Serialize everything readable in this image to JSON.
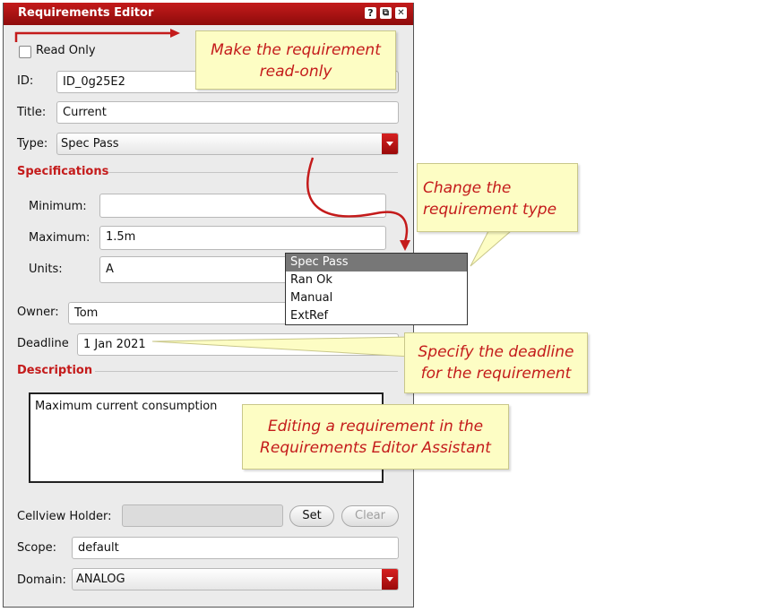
{
  "window": {
    "title": "Requirements Editor",
    "help_glyph": "?",
    "restore_glyph": "⧉",
    "close_glyph": "✕"
  },
  "readonly": {
    "label": "Read Only",
    "checked": false
  },
  "form": {
    "id": {
      "label": "ID:",
      "value": "ID_0g25E2"
    },
    "title": {
      "label": "Title:",
      "value": "Current"
    },
    "type": {
      "label": "Type:",
      "value": "Spec Pass"
    }
  },
  "specifications": {
    "heading": "Specifications",
    "minimum": {
      "label": "Minimum:",
      "value": ""
    },
    "maximum": {
      "label": "Maximum:",
      "value": "1.5m"
    },
    "units": {
      "label": "Units:",
      "value": "A"
    }
  },
  "owner": {
    "label": "Owner:",
    "value": "Tom"
  },
  "deadline": {
    "label": "Deadline",
    "value": "1 Jan 2021"
  },
  "description": {
    "heading": "Description",
    "value": "Maximum current consumption"
  },
  "cellview": {
    "label": "Cellview Holder:",
    "value": "",
    "set_label": "Set",
    "clear_label": "Clear"
  },
  "scope": {
    "label": "Scope:",
    "value": "default"
  },
  "domain": {
    "label": "Domain:",
    "value": "ANALOG"
  },
  "type_options": [
    "Spec Pass",
    "Ran Ok",
    "Manual",
    "ExtRef"
  ],
  "callouts": {
    "readonly": [
      "Make the requirement",
      "read-only"
    ],
    "type": [
      "Change the",
      "requirement type"
    ],
    "deadline": [
      "Specify the deadline",
      "for the requirement"
    ],
    "editing": [
      "Editing a requirement in the",
      "Requirements Editor Assistant"
    ]
  },
  "colors": {
    "accent": "#c41b1b",
    "callout_bg": "#fdfdc4",
    "callout_text": "#c41b1b"
  }
}
